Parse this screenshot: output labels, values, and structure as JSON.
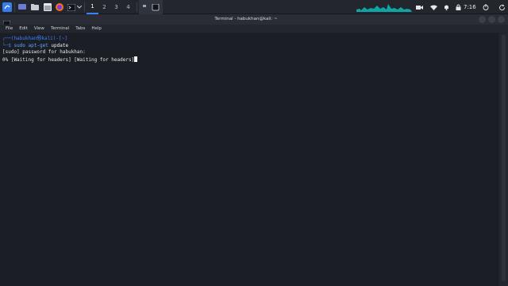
{
  "taskbar": {
    "workspaces": [
      "1",
      "2",
      "3",
      "4"
    ],
    "active_workspace": "1",
    "clock": "7:16",
    "icons": [
      "kali-menu-icon",
      "desktop-icon",
      "files-icon",
      "firefox-icon",
      "terminal-icon",
      "chevron-down-icon",
      "terminal-task-icon",
      "network-graph-icon",
      "camera-icon",
      "wifi-icon",
      "bell-icon",
      "lock-icon",
      "power-icon",
      "refresh-icon"
    ]
  },
  "window": {
    "title": "Terminal - habukhan@kali: ~",
    "menu": [
      "File",
      "Edit",
      "View",
      "Terminal",
      "Tabs",
      "Help"
    ]
  },
  "terminal": {
    "prompt_line1": "┌──(habukhan㉿kali)-[~]",
    "prompt_line2_prefix": "└─$ ",
    "command_sudo": "sudo apt-get",
    "command_rest": " update",
    "output1": "[sudo] password for habukhan:",
    "output2": "0% [Waiting for headers] [Waiting for headers]"
  },
  "colors": {
    "accent": "#3b82f6",
    "background": "#1c1e25",
    "text": "#e5e7eb"
  }
}
